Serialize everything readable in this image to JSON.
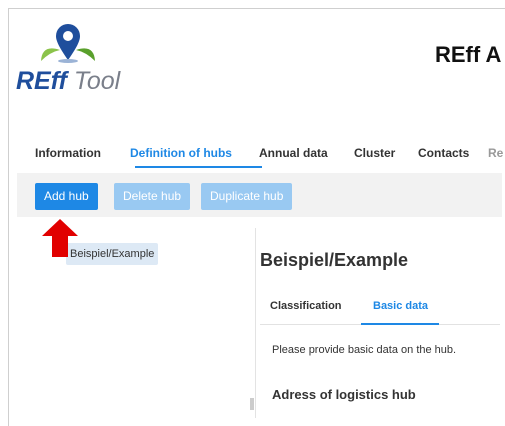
{
  "app": {
    "title": "REff A",
    "logo": {
      "main": "REff ",
      "accent": "Tool"
    }
  },
  "tabs": [
    {
      "label": "Information"
    },
    {
      "label": "Definition of hubs",
      "active": true
    },
    {
      "label": "Annual data"
    },
    {
      "label": "Cluster"
    },
    {
      "label": "Contacts"
    },
    {
      "label": "Re"
    }
  ],
  "toolbar": {
    "add_label": "Add hub",
    "delete_label": "Delete hub",
    "duplicate_label": "Duplicate hub"
  },
  "hub_list": [
    {
      "label": "Beispiel/Example",
      "selected": true
    }
  ],
  "detail": {
    "title": "Beispiel/Example",
    "subtabs": [
      {
        "label": "Classification"
      },
      {
        "label": "Basic data",
        "active": true
      }
    ],
    "help_text": "Please provide basic data on the hub.",
    "section_title": "Adress of logistics hub"
  },
  "colors": {
    "accent": "#1e88e5",
    "button_disabled": "#99c9f2",
    "logo_blue": "#1f4e9c",
    "annotation_arrow": "#e10000"
  }
}
